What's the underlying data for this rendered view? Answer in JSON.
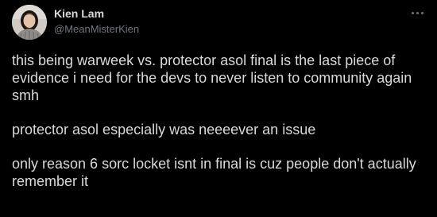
{
  "author": {
    "name": "Kien Lam",
    "handle": "@MeanMisterKien"
  },
  "icons": {
    "avatar": "profile-photo",
    "more": "more-options-icon"
  },
  "colors": {
    "background": "#000000",
    "text": "#d9d9d9",
    "secondary_text": "#6e767d"
  },
  "tweet": {
    "paragraphs": [
      "this being warweek vs. protector asol final is the last piece of evidence i need for the devs to never listen to community again smh",
      "protector asol especially was neeeever an issue",
      "only reason 6 sorc locket isnt in final is cuz people don't actually remember it"
    ]
  }
}
